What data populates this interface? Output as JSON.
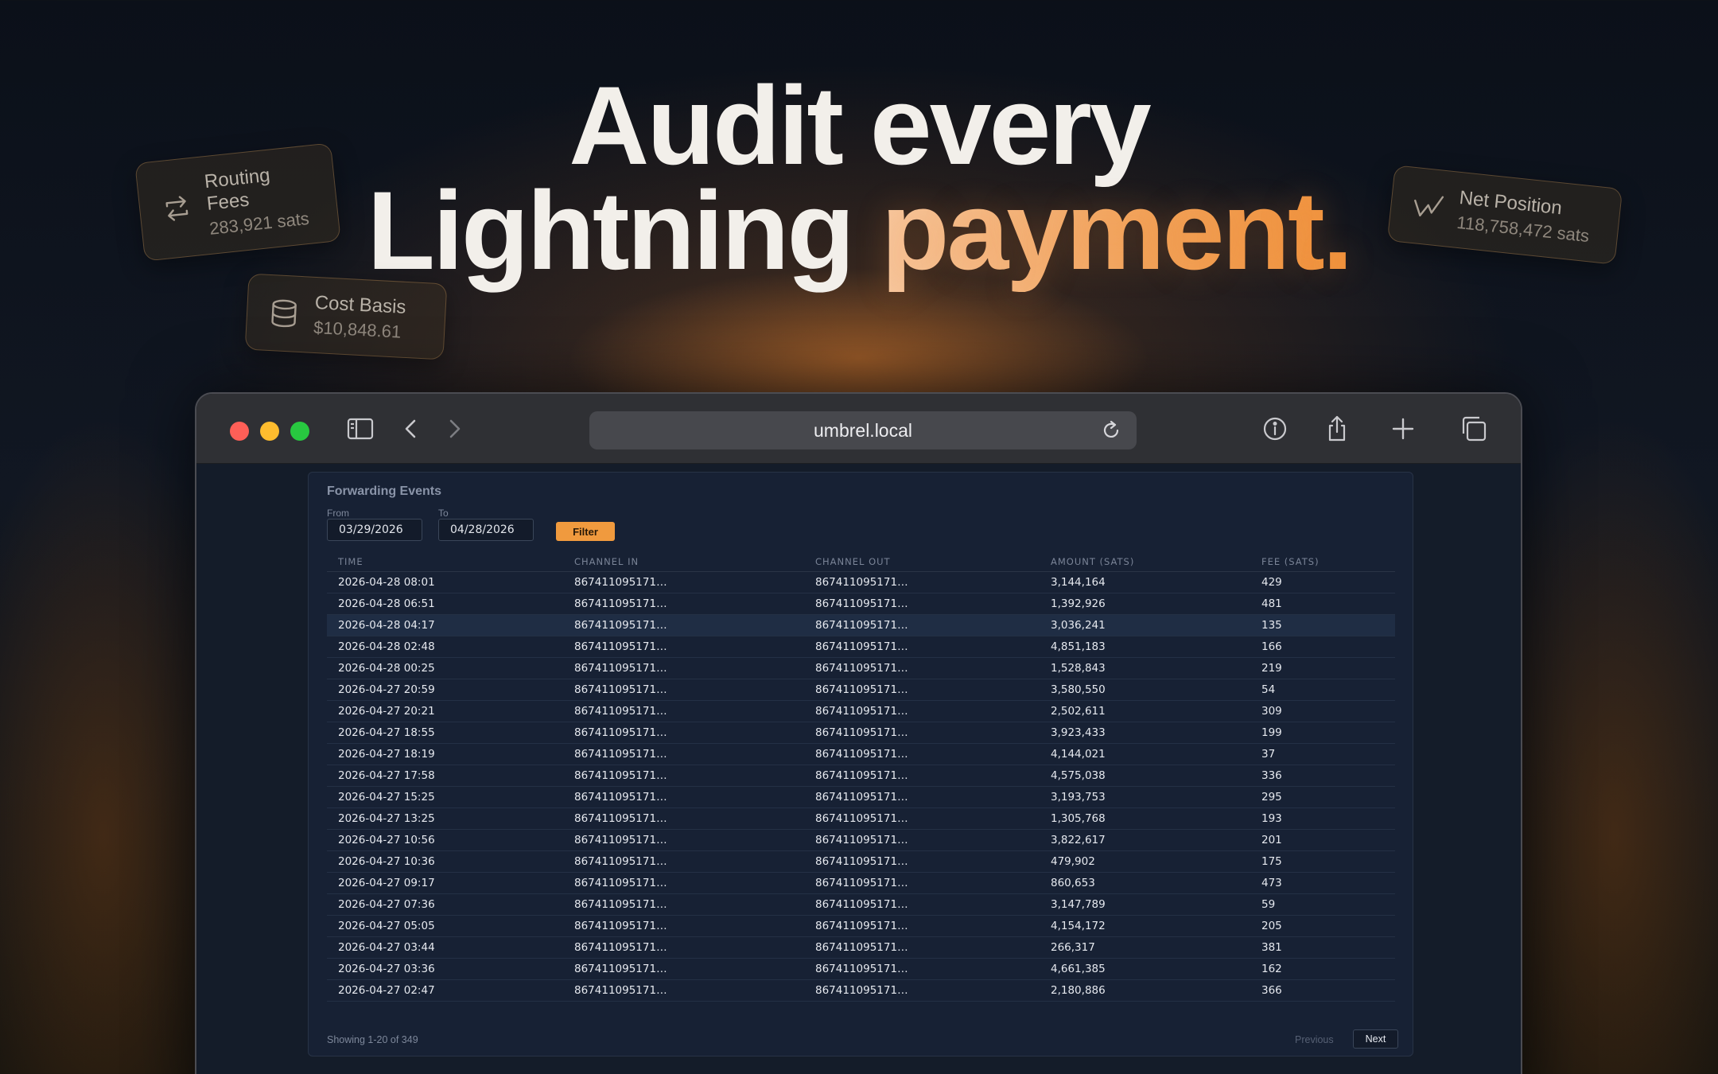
{
  "headline": {
    "line1": "Audit every",
    "line2_plain": "Lightning",
    "line2_accent": "payment."
  },
  "stat_cards": {
    "routing": {
      "title": "Routing Fees",
      "value": "283,921 sats",
      "icon": "arrows-exchange-icon"
    },
    "cost": {
      "title": "Cost Basis",
      "value": "$10,848.61",
      "icon": "database-icon"
    },
    "net": {
      "title": "Net Position",
      "value": "118,758,472 sats",
      "icon": "trend-line-icon"
    }
  },
  "browser": {
    "url": "umbrel.local",
    "colors": {
      "close": "#fe5f57",
      "minimize": "#febc2e",
      "maximize": "#28c840"
    }
  },
  "forwarding": {
    "title": "Forwarding Events",
    "from_label": "From",
    "to_label": "To",
    "from_value": "03/29/2026",
    "to_value": "04/28/2026",
    "filter_label": "Filter",
    "accent_color": "#f09a3e",
    "columns": [
      "TIME",
      "CHANNEL IN",
      "CHANNEL OUT",
      "AMOUNT (SATS)",
      "FEE (SATS)"
    ],
    "rows": [
      [
        "2026-04-28 08:01",
        "867411095171…",
        "867411095171…",
        "3,144,164",
        "429"
      ],
      [
        "2026-04-28 06:51",
        "867411095171…",
        "867411095171…",
        "1,392,926",
        "481"
      ],
      [
        "2026-04-28 04:17",
        "867411095171…",
        "867411095171…",
        "3,036,241",
        "135"
      ],
      [
        "2026-04-28 02:48",
        "867411095171…",
        "867411095171…",
        "4,851,183",
        "166"
      ],
      [
        "2026-04-28 00:25",
        "867411095171…",
        "867411095171…",
        "1,528,843",
        "219"
      ],
      [
        "2026-04-27 20:59",
        "867411095171…",
        "867411095171…",
        "3,580,550",
        "54"
      ],
      [
        "2026-04-27 20:21",
        "867411095171…",
        "867411095171…",
        "2,502,611",
        "309"
      ],
      [
        "2026-04-27 18:55",
        "867411095171…",
        "867411095171…",
        "3,923,433",
        "199"
      ],
      [
        "2026-04-27 18:19",
        "867411095171…",
        "867411095171…",
        "4,144,021",
        "37"
      ],
      [
        "2026-04-27 17:58",
        "867411095171…",
        "867411095171…",
        "4,575,038",
        "336"
      ],
      [
        "2026-04-27 15:25",
        "867411095171…",
        "867411095171…",
        "3,193,753",
        "295"
      ],
      [
        "2026-04-27 13:25",
        "867411095171…",
        "867411095171…",
        "1,305,768",
        "193"
      ],
      [
        "2026-04-27 10:56",
        "867411095171…",
        "867411095171…",
        "3,822,617",
        "201"
      ],
      [
        "2026-04-27 10:36",
        "867411095171…",
        "867411095171…",
        "479,902",
        "175"
      ],
      [
        "2026-04-27 09:17",
        "867411095171…",
        "867411095171…",
        "860,653",
        "473"
      ],
      [
        "2026-04-27 07:36",
        "867411095171…",
        "867411095171…",
        "3,147,789",
        "59"
      ],
      [
        "2026-04-27 05:05",
        "867411095171…",
        "867411095171…",
        "4,154,172",
        "205"
      ],
      [
        "2026-04-27 03:44",
        "867411095171…",
        "867411095171…",
        "266,317",
        "381"
      ],
      [
        "2026-04-27 03:36",
        "867411095171…",
        "867411095171…",
        "4,661,385",
        "162"
      ],
      [
        "2026-04-27 02:47",
        "867411095171…",
        "867411095171…",
        "2,180,886",
        "366"
      ]
    ],
    "highlighted_row": 3,
    "showing_text": "Showing 1-20 of 349",
    "previous_label": "Previous",
    "next_label": "Next"
  }
}
